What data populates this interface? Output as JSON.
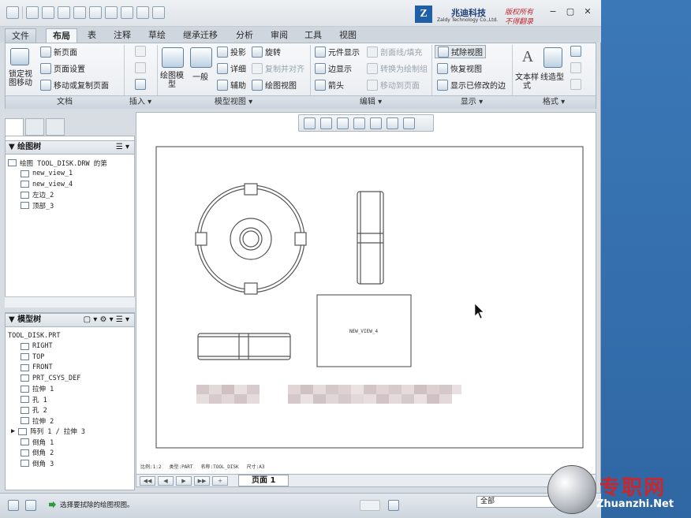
{
  "brand": {
    "logo": "Z",
    "name": "兆迪科技",
    "subname": "Zaldy Technology Co.,Ltd.",
    "slogan1": "版权所有",
    "slogan2": "不得翻录"
  },
  "menu_tabs": [
    "文件",
    "布局",
    "表",
    "注释",
    "草绘",
    "继承迁移",
    "分析",
    "审阅",
    "工具",
    "视图"
  ],
  "active_tab": "布局",
  "ribbon": {
    "doc": {
      "lock": "锁定视图移动",
      "new_page": "新页面",
      "page_setup": "页面设置",
      "move_copy": "移动或复制页面"
    },
    "view": {
      "drawing_model": "绘图模型",
      "general": "一般",
      "projection": "投影",
      "detail": "详细",
      "auxiliary": "辅助",
      "revolve": "旋转",
      "copy_align": "复制并对齐",
      "drawing_view": "绘图视图"
    },
    "edit": {
      "element_display": "元件显示",
      "edge_display": "边显示",
      "arrow": "箭头",
      "section_fill": "剖面线/填充",
      "convert_group": "转换为绘制组",
      "move_page": "移动到页面"
    },
    "display": {
      "erase_view": "拭除视图",
      "restore_view": "恢复视图",
      "show_modified": "显示已修改的边"
    },
    "format": {
      "text_style": "文本样式",
      "line_style": "线造型"
    },
    "groups": {
      "doc": "文档",
      "insert": "插入 ▾",
      "model_views": "模型视图 ▾",
      "edit": "编辑 ▾",
      "display": "显示 ▾",
      "format": "格式 ▾"
    }
  },
  "drawing_tree": {
    "title": "绘图树",
    "items": [
      "绘图 TOOL_DISK.DRW 的第",
      "new_view_1",
      "new_view_4",
      "左边_2",
      "顶部_3"
    ]
  },
  "model_tree": {
    "title": "模型树",
    "items": [
      "TOOL_DISK.PRT",
      "RIGHT",
      "TOP",
      "FRONT",
      "PRT_CSYS_DEF",
      "拉伸 1",
      "孔 1",
      "孔 2",
      "拉伸 2",
      "阵列 1 / 拉伸 3",
      "倒角 1",
      "倒角 2",
      "倒角 3"
    ]
  },
  "canvas": {
    "view_label": "NEW_VIEW_4",
    "sheet_info": [
      "比例:1:2",
      "类型:PART",
      "名称:TOOL_DISK",
      "尺寸:A3"
    ]
  },
  "page_tab": "页面 1",
  "status_msg": "选择要拭除的绘图视图。",
  "filter_value": "全部",
  "watermark": {
    "site": "专职网",
    "url": "Zhuanzhi.Net"
  }
}
